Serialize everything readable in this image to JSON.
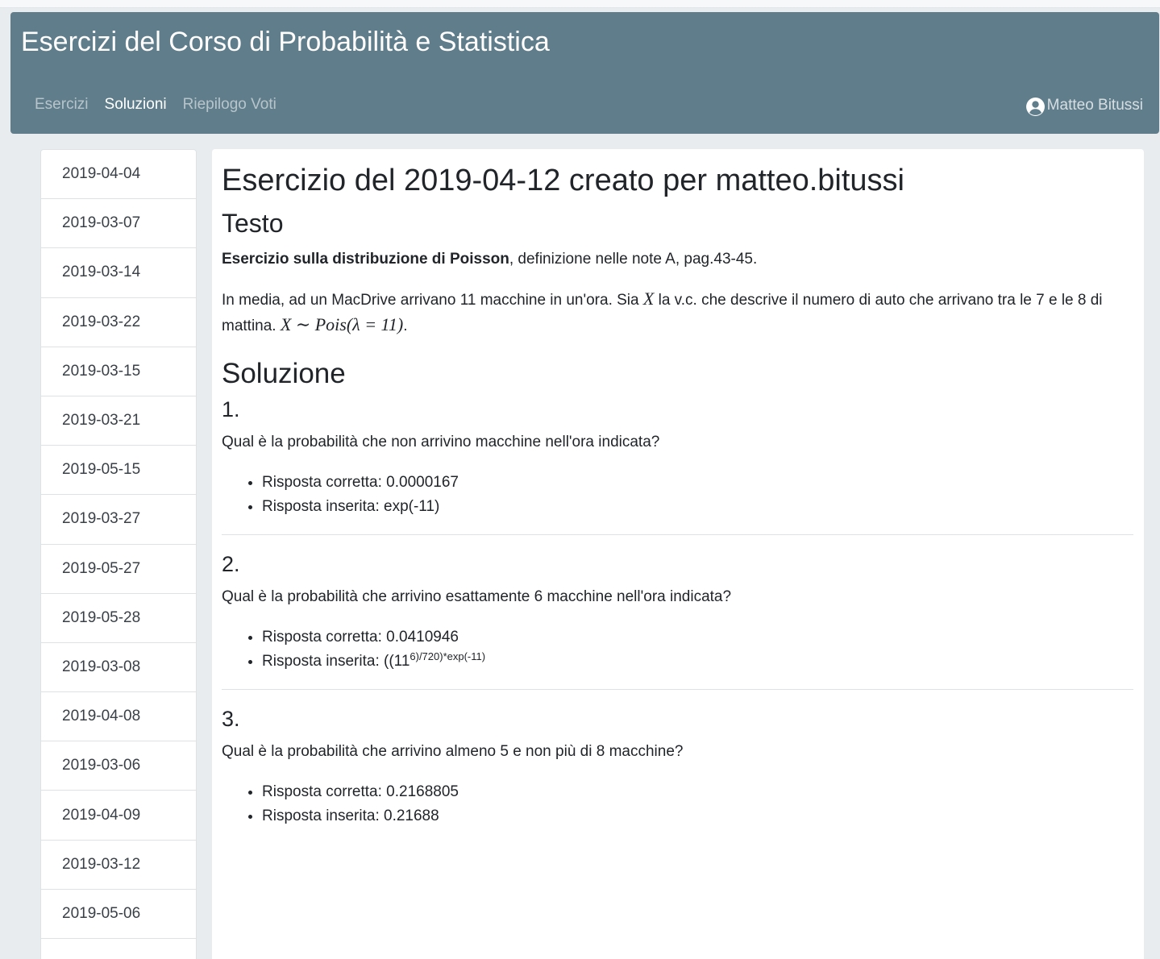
{
  "app": {
    "title": "Esercizi del Corso di Probabilità e Statistica",
    "nav": [
      "Esercizi",
      "Soluzioni",
      "Riepilogo Voti"
    ],
    "active_nav": "Soluzioni",
    "user": "Matteo Bitussi"
  },
  "sidebar": {
    "dates": [
      "2019-04-04",
      "2019-03-07",
      "2019-03-14",
      "2019-03-22",
      "2019-03-15",
      "2019-03-21",
      "2019-05-15",
      "2019-03-27",
      "2019-05-27",
      "2019-05-28",
      "2019-03-08",
      "2019-04-08",
      "2019-03-06",
      "2019-04-09",
      "2019-03-12",
      "2019-05-06"
    ]
  },
  "main": {
    "heading": "Esercizio del 2019-04-12 creato per matteo.bitussi",
    "testo_title": "Testo",
    "intro_bold": "Esercizio sulla distribuzione di Poisson",
    "intro_rest": ", definizione nelle note A, pag.43-45.",
    "problem_part1": "In media, ad un MacDrive arrivano 11 macchine in un'ora. Sia ",
    "problem_var": "X",
    "problem_part2": " la v.c. che descrive il numero di auto che arrivano tra le 7 e le 8 di mattina. ",
    "problem_formula": "X ∼ Pois(λ = 11)",
    "problem_end": ".",
    "solution_title": "Soluzione",
    "questions": [
      {
        "number": "1.",
        "text": "Qual è la probabilità che non arrivino macchine nell'ora indicata?",
        "correct": "Risposta corretta: 0.0000167",
        "given": "Risposta inserita: exp(-11)"
      },
      {
        "number": "2.",
        "text": "Qual è la probabilità che arrivino esattamente 6 macchine nell'ora indicata?",
        "correct": "Risposta corretta: 0.0410946",
        "given_base": "Risposta inserita: ((11",
        "given_sup": "6)/720)*exp(-11)"
      },
      {
        "number": "3.",
        "text": "Qual è la probabilità che arrivino almeno 5 e non più di 8 macchine?",
        "correct": "Risposta corretta: 0.2168805",
        "given": "Risposta inserita: 0.21688"
      }
    ]
  }
}
